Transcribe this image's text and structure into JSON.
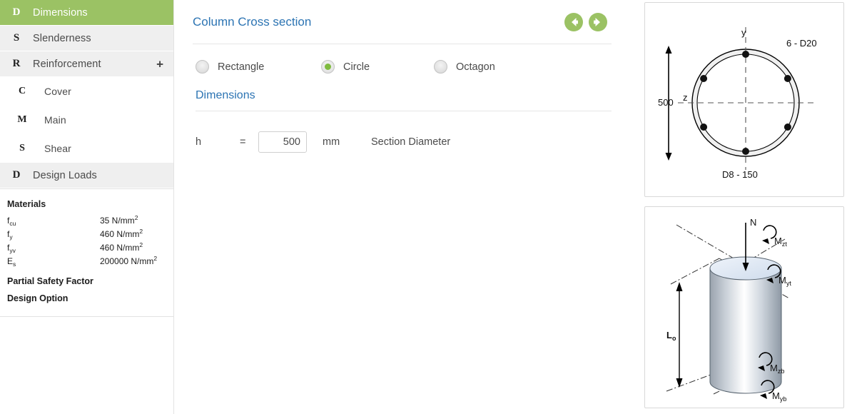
{
  "theme": {
    "accent_green": "#9bc264",
    "title_blue": "#2c74b3",
    "radio_green": "#7fbb3f",
    "sidebar_bg": "#efefef"
  },
  "sidebar": {
    "items": [
      {
        "icon": "D",
        "label": "Dimensions",
        "active": true,
        "sub": false,
        "expandable": false
      },
      {
        "icon": "S",
        "label": "Slenderness",
        "active": false,
        "sub": false,
        "expandable": false
      },
      {
        "icon": "R",
        "label": "Reinforcement",
        "active": false,
        "sub": false,
        "expandable": true,
        "expand_glyph": "+"
      },
      {
        "icon": "C",
        "label": "Cover",
        "active": false,
        "sub": true,
        "expandable": false
      },
      {
        "icon": "M",
        "label": "Main",
        "active": false,
        "sub": true,
        "expandable": false
      },
      {
        "icon": "S",
        "label": "Shear",
        "active": false,
        "sub": true,
        "expandable": false
      },
      {
        "icon": "D",
        "label": "Design Loads",
        "active": false,
        "sub": false,
        "expandable": false
      }
    ],
    "materials": {
      "title": "Materials",
      "rows": [
        {
          "symbol": "f",
          "symbol_sub": "cu",
          "value": "35 N/mm",
          "value_sup": "2"
        },
        {
          "symbol": "f",
          "symbol_sub": "y",
          "value": "460 N/mm",
          "value_sup": "2"
        },
        {
          "symbol": "f",
          "symbol_sub": "yv",
          "value": "460 N/mm",
          "value_sup": "2"
        },
        {
          "symbol": "E",
          "symbol_sub": "s",
          "value": "200000 N/mm",
          "value_sup": "2"
        }
      ]
    },
    "links": [
      {
        "label": "Partial Safety Factor"
      },
      {
        "label": "Design Option"
      }
    ]
  },
  "main": {
    "page_title": "Column Cross section",
    "nav": {
      "back_label": "Back",
      "next_label": "Next"
    },
    "shape_options": [
      {
        "label": "Rectangle",
        "selected": false
      },
      {
        "label": "Circle",
        "selected": true
      },
      {
        "label": "Octagon",
        "selected": false
      }
    ],
    "dimensions": {
      "section_title": "Dimensions",
      "fields": [
        {
          "name": "h",
          "operator": "=",
          "value": "500",
          "unit": "mm",
          "description": "Section Diameter"
        }
      ]
    }
  },
  "cross_section": {
    "dimension_label": "500",
    "axis_y_label": "y",
    "axis_z_label": "z",
    "main_bars_label": "6 - D20",
    "links_label": "D8 - 150",
    "bar_count": 6
  },
  "column_3d": {
    "axial_label": "N",
    "length_label": "L",
    "length_label_sub": "o",
    "moments": [
      {
        "id": "mzt",
        "base": "M",
        "sub": "zt"
      },
      {
        "id": "myt",
        "base": "M",
        "sub": "yt"
      },
      {
        "id": "mzb",
        "base": "M",
        "sub": "zb"
      },
      {
        "id": "myb",
        "base": "M",
        "sub": "yb"
      }
    ]
  }
}
